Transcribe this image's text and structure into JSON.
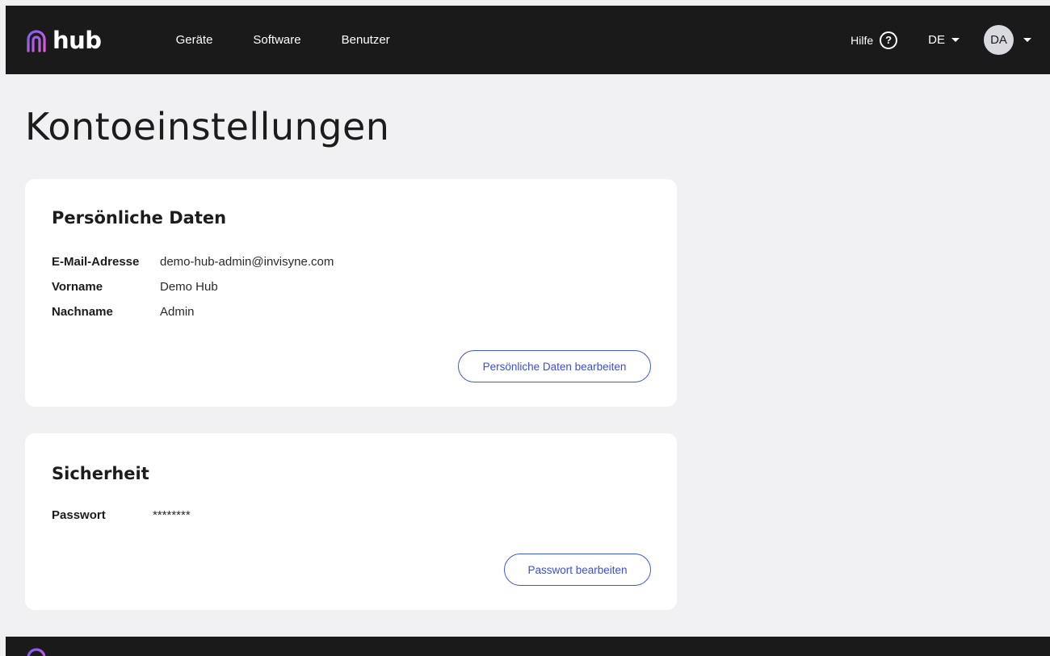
{
  "header": {
    "logo_text": "hub",
    "nav": [
      {
        "label": "Geräte"
      },
      {
        "label": "Software"
      },
      {
        "label": "Benutzer"
      }
    ],
    "help_label": "Hilfe",
    "help_icon": "?",
    "language": "DE",
    "user_initials": "DA"
  },
  "page": {
    "title": "Kontoeinstellungen"
  },
  "personal": {
    "title": "Persönliche Daten",
    "fields": [
      {
        "label": "E-Mail-Adresse",
        "value": "demo-hub-admin@invisyne.com"
      },
      {
        "label": "Vorname",
        "value": "Demo Hub"
      },
      {
        "label": "Nachname",
        "value": "Admin"
      }
    ],
    "edit_button": "Persönliche Daten bearbeiten"
  },
  "security": {
    "title": "Sicherheit",
    "fields": [
      {
        "label": "Passwort",
        "value": "********"
      }
    ],
    "edit_button": "Passwort bearbeiten"
  },
  "colors": {
    "header_bg": "#1a1a1a",
    "page_bg": "#f1f1f3",
    "accent": "#3c4fd0",
    "logo_gradient_start": "#7b5cf5",
    "logo_gradient_end": "#e05fd0"
  }
}
